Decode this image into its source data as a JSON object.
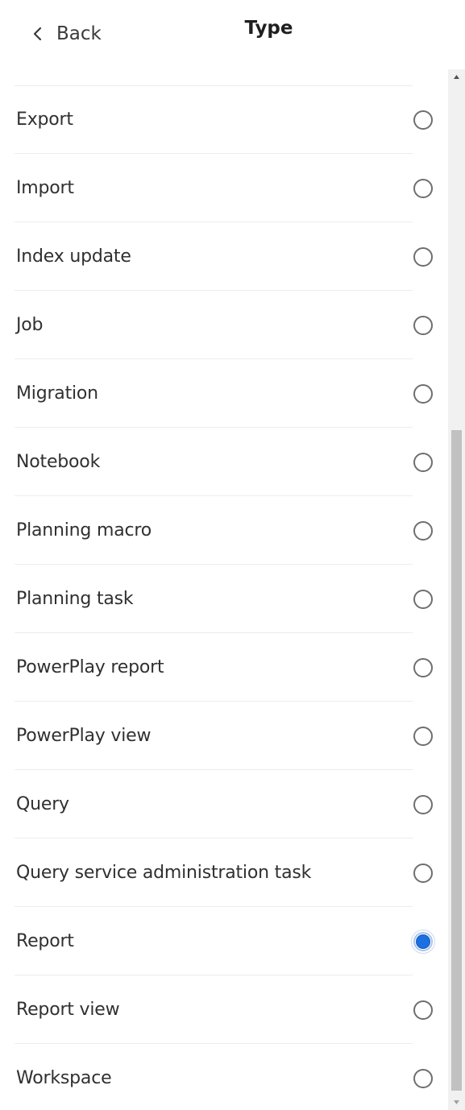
{
  "header": {
    "back_label": "Back",
    "title": "Type"
  },
  "list": {
    "items": [
      {
        "label": "Export",
        "selected": false
      },
      {
        "label": "Import",
        "selected": false
      },
      {
        "label": "Index update",
        "selected": false
      },
      {
        "label": "Job",
        "selected": false
      },
      {
        "label": "Migration",
        "selected": false
      },
      {
        "label": "Notebook",
        "selected": false
      },
      {
        "label": "Planning macro",
        "selected": false
      },
      {
        "label": "Planning task",
        "selected": false
      },
      {
        "label": "PowerPlay report",
        "selected": false
      },
      {
        "label": "PowerPlay view",
        "selected": false
      },
      {
        "label": "Query",
        "selected": false
      },
      {
        "label": "Query service administration task",
        "selected": false
      },
      {
        "label": "Report",
        "selected": true
      },
      {
        "label": "Report view",
        "selected": false
      },
      {
        "label": "Workspace",
        "selected": false
      }
    ]
  },
  "icons": {
    "back": "chevron-left-icon",
    "scroll_up": "triangle-up-icon",
    "scroll_down": "triangle-down-icon"
  },
  "colors": {
    "radio_selected": "#1c6fe0",
    "radio_border": "#6e6e6e",
    "divider": "#ececec"
  }
}
